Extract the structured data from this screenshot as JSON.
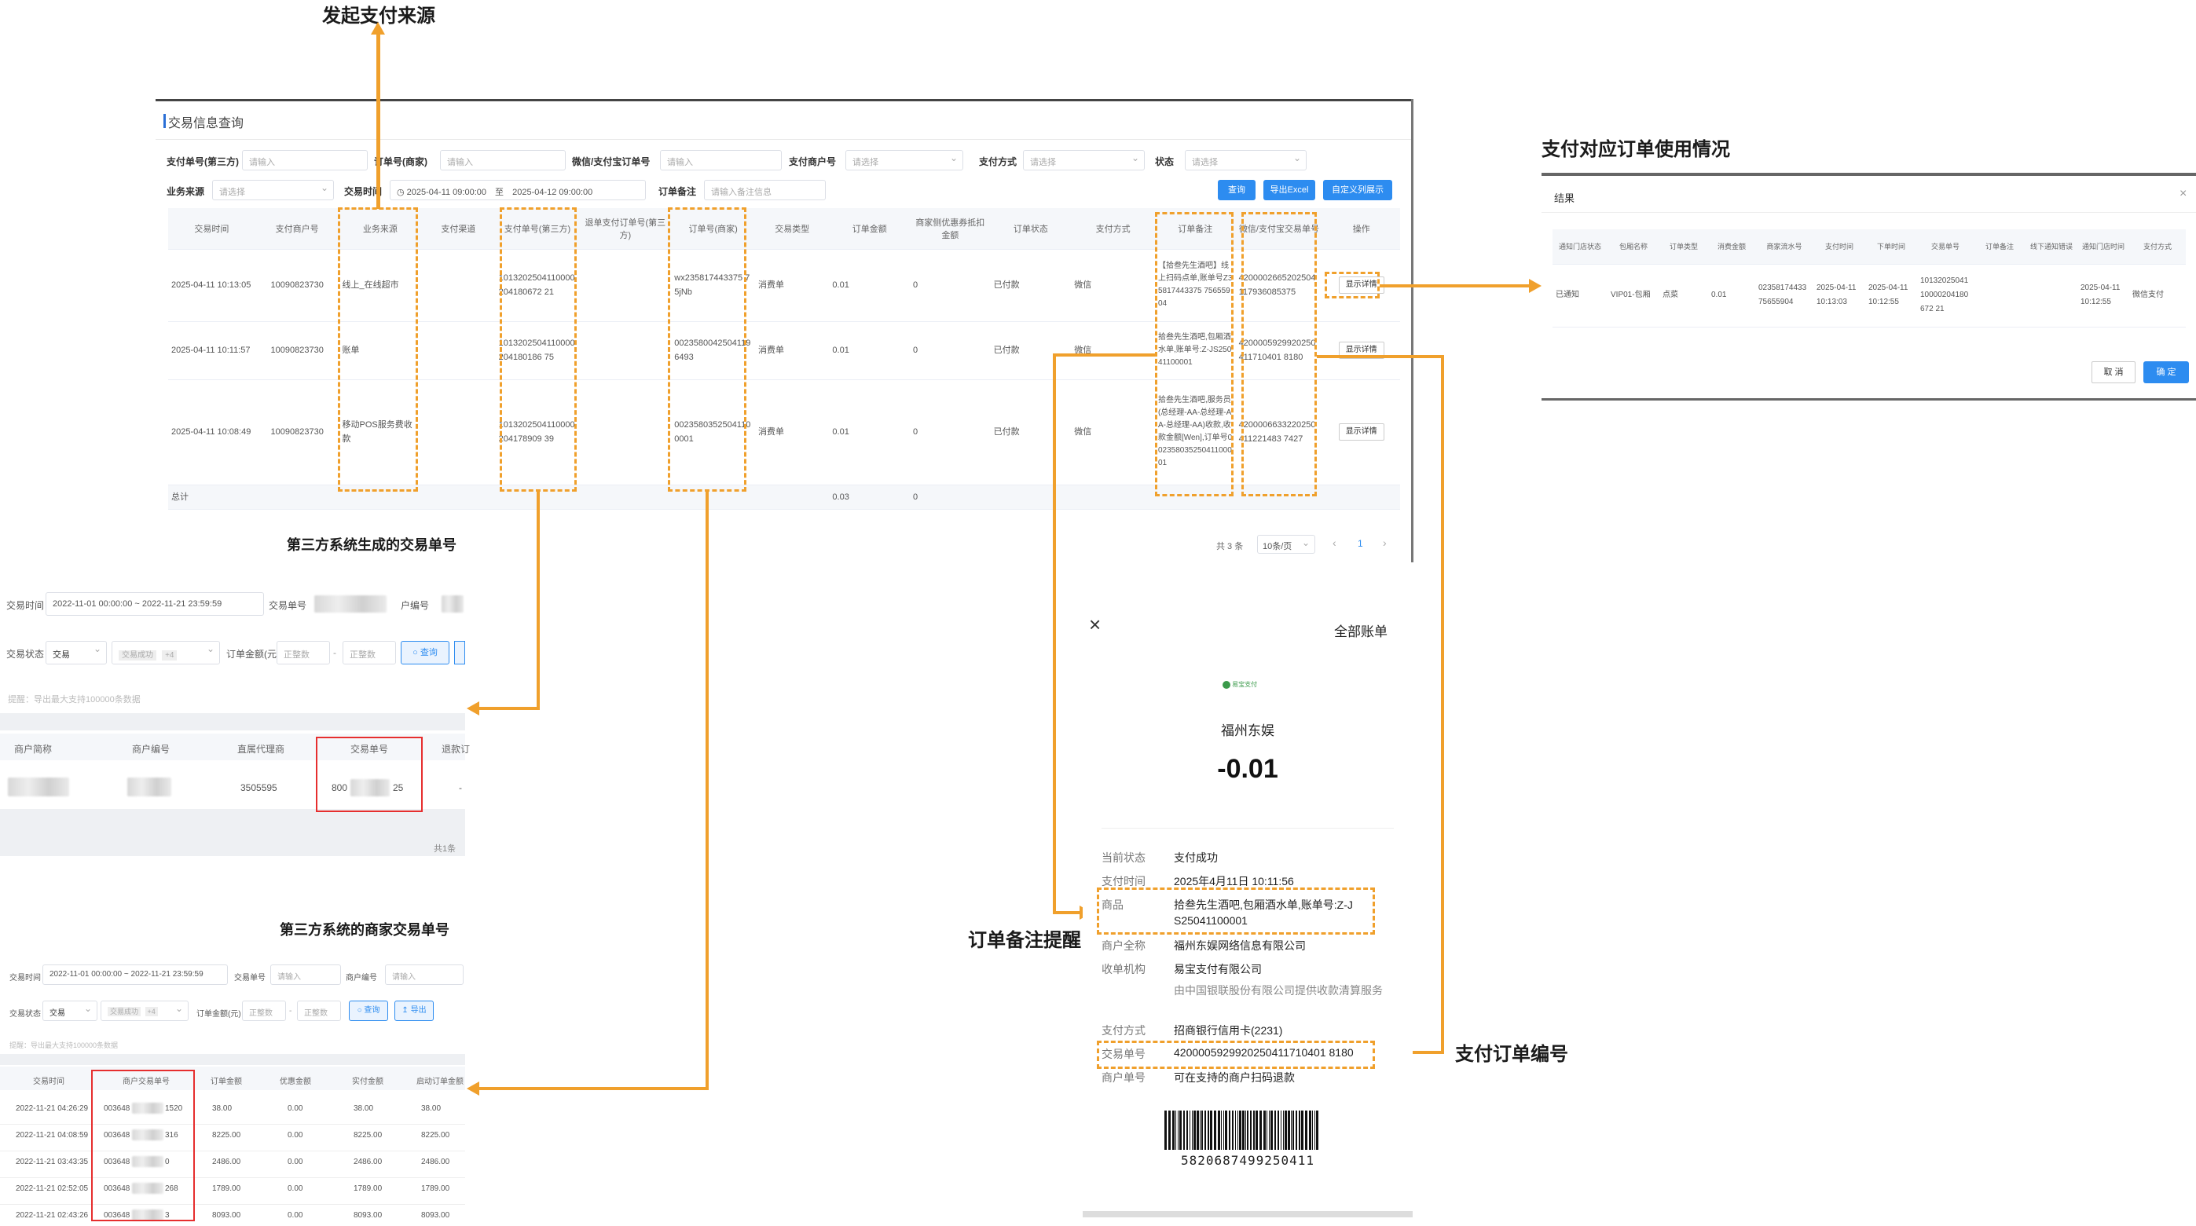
{
  "annotations": {
    "source": "发起支付来源",
    "usage": "支付对应订单使用情况",
    "third_party_trade_no": "第三方系统生成的交易单号",
    "third_party_merchant_no": "第三方系统的商家交易单号",
    "order_remark": "订单备注提醒",
    "pay_order_no": "支付订单编号"
  },
  "main": {
    "title": "交易信息查询",
    "filters": {
      "pay_no_label": "支付单号(第三方)",
      "pay_no_ph": "请输入",
      "order_no_label": "订单号(商家)",
      "order_no_ph": "请输入",
      "wx_no_label": "微信/支付宝订单号",
      "wx_no_ph": "请输入",
      "merchant_label": "支付商户号",
      "merchant_ph": "请选择",
      "pay_method_label": "支付方式",
      "pay_method_ph": "请选择",
      "status_label": "状态",
      "status_ph": "请选择",
      "source_label": "业务来源",
      "source_ph": "请选择",
      "time_label": "交易时间",
      "time_start": "2025-04-11 09:00:00",
      "time_sep": "至",
      "time_end": "2025-04-12 09:00:00",
      "remark_label": "订单备注",
      "remark_ph": "请输入备注信息"
    },
    "buttons": {
      "query": "查询",
      "export": "导出Excel",
      "define": "自定义列展示"
    },
    "columns": [
      "交易时间",
      "支付商户号",
      "业务来源",
      "支付渠道",
      "支付单号(第三方)",
      "退单支付订单号(第三方)",
      "订单号(商家)",
      "交易类型",
      "订单金额",
      "商家侧优惠券抵扣金额",
      "订单状态",
      "支付方式",
      "订单备注",
      "微信/支付宝交易单号",
      "操作"
    ],
    "rows": [
      {
        "time": "2025-04-11 10:13:05",
        "merchant": "10090823730",
        "source": "线上_在线超市",
        "channel": "",
        "payno": "1013202504110000204180672 21",
        "refund": "",
        "orderno": "wx235817443375 75jNb",
        "type": "消费单",
        "amount": "0.01",
        "discount": "0",
        "status": "已付款",
        "method": "微信",
        "remark": "【拾叁先生酒吧】线上扫码点单,账单号Z35817443375 75655904",
        "wxno": "4200002665202504117936085375",
        "action": "显示详情"
      },
      {
        "time": "2025-04-11 10:11:57",
        "merchant": "10090823730",
        "source": "账单",
        "channel": "",
        "payno": "1013202504110000204180186 75",
        "refund": "",
        "orderno": "0023580042504119 6493",
        "type": "消费单",
        "amount": "0.01",
        "discount": "0",
        "status": "已付款",
        "method": "微信",
        "remark": "拾叁先生酒吧,包厢酒水单,账单号:Z-JS25041100001",
        "wxno": "4200005929920250411710401 8180",
        "action": "显示详情"
      },
      {
        "time": "2025-04-11 10:08:49",
        "merchant": "10090823730",
        "source": "移动POS服务费收款",
        "channel": "",
        "payno": "1013202504110000204178909 39",
        "refund": "",
        "orderno": "0023580352504110 0001",
        "type": "消费单",
        "amount": "0.01",
        "discount": "0",
        "status": "已付款",
        "method": "微信",
        "remark": "拾叁先生酒吧,服务员(总经理-AA-总经理-AA-总经理-AA)收款,收款金额[Wen],订单号00235803525041100001",
        "wxno": "4200006633220250411221483 7427",
        "action": "显示详情"
      }
    ],
    "total_label": "总计",
    "total_amount": "0.03",
    "total_discount": "0",
    "pager": {
      "count": "共 3 条",
      "size": "10条/页",
      "prev": "‹",
      "page": "1",
      "next": "›"
    }
  },
  "result": {
    "title": "结果",
    "close": "×",
    "columns": [
      "通知门店状态",
      "包厢名称",
      "订单类型",
      "消费金额",
      "商家流水号",
      "支付时间",
      "下单时间",
      "交易单号",
      "订单备注",
      "线下通知错误",
      "通知门店时间",
      "支付方式"
    ],
    "row": [
      "已通知",
      "VIP01-包厢",
      "点菜",
      "0.01",
      "0235817443375655904",
      "2025-04-11 10:13:03",
      "2025-04-11 10:12:55",
      "1013202504110000204180672 21",
      "",
      "",
      "2025-04-11 10:12:55",
      "微信支付"
    ],
    "cancel": "取 消",
    "ok": "确 定"
  },
  "tp1": {
    "time_label": "交易时间",
    "time_val": "2022-11-01 00:00:00  ~  2022-11-21 23:59:59",
    "tradeno_label": "交易单号",
    "merchant_label": "户编号",
    "status_label": "交易状态",
    "status_val": "交易",
    "type_val": "交易成功",
    "type_count": "+4",
    "amount_label": "订单金额(元)",
    "amount_ph1": "正整数",
    "amount_sep": "-",
    "amount_ph2": "正整数",
    "query": "查询",
    "hint": "提醒：导出最大支持100000条数据",
    "columns": [
      "商户简称",
      "商户编号",
      "直属代理商",
      "交易单号",
      "退款订"
    ],
    "row_agent": "3505595",
    "row_trade_prefix": "800",
    "row_trade_suffix": "25",
    "row_dash": "-",
    "footer": "共1条"
  },
  "tp2": {
    "time_label": "交易时间",
    "time_val": "2022-11-01 00:00:00  ~  2022-11-21 23:59:59",
    "tradeno_label": "交易单号",
    "tradeno_ph": "请输入",
    "merchant_label": "商户编号",
    "merchant_ph": "请输入",
    "status_label": "交易状态",
    "status_val": "交易",
    "type_val": "交易成功",
    "type_count": "+4",
    "amount_label": "订单金额(元)",
    "amount_ph1": "正整数",
    "amount_sep": "-",
    "amount_ph2": "正整数",
    "query": "查询",
    "export": "导出",
    "hint": "提醒：导出最大支持100000条数据",
    "columns": [
      "交易时间",
      "商户交易单号",
      "订单金额",
      "优惠金额",
      "实付金额",
      "启动订单金额"
    ],
    "rows": [
      [
        "2022-11-21 04:26:29",
        "003648",
        "1520",
        "38.00",
        "0.00",
        "38.00",
        "38.00"
      ],
      [
        "2022-11-21 04:08:59",
        "003648",
        "316",
        "8225.00",
        "0.00",
        "8225.00",
        "8225.00"
      ],
      [
        "2022-11-21 03:43:35",
        "003648",
        "0",
        "2486.00",
        "0.00",
        "2486.00",
        "2486.00"
      ],
      [
        "2022-11-21 02:52:05",
        "003648",
        "268",
        "1789.00",
        "0.00",
        "1789.00",
        "1789.00"
      ],
      [
        "2022-11-21 02:43:26",
        "003648",
        "3",
        "8093.00",
        "0.00",
        "8093.00",
        "8093.00"
      ]
    ]
  },
  "receipt": {
    "close": "×",
    "all_bills": "全部账单",
    "brand": "易宝支付",
    "merchant_name": "福州东娱",
    "amount": "-0.01",
    "fields": [
      {
        "k": "当前状态",
        "v": "支付成功"
      },
      {
        "k": "支付时间",
        "v": "2025年4月11日 10:11:56"
      },
      {
        "k": "商品",
        "v": "拾叁先生酒吧,包厢酒水单,账单号:Z-JS25041100001"
      },
      {
        "k": "商户全称",
        "v": "福州东娱网络信息有限公司"
      },
      {
        "k": "收单机构",
        "v": "易宝支付有限公司"
      },
      {
        "k": "",
        "v": "由中国银联股份有限公司提供收款清算服务"
      },
      {
        "k": "支付方式",
        "v": "招商银行信用卡(2231)"
      },
      {
        "k": "交易单号",
        "v": "4200005929920250411710401 8180"
      },
      {
        "k": "商户单号",
        "v": "可在支持的商户扫码退款"
      }
    ],
    "barcode_no": "5820687499250411"
  }
}
